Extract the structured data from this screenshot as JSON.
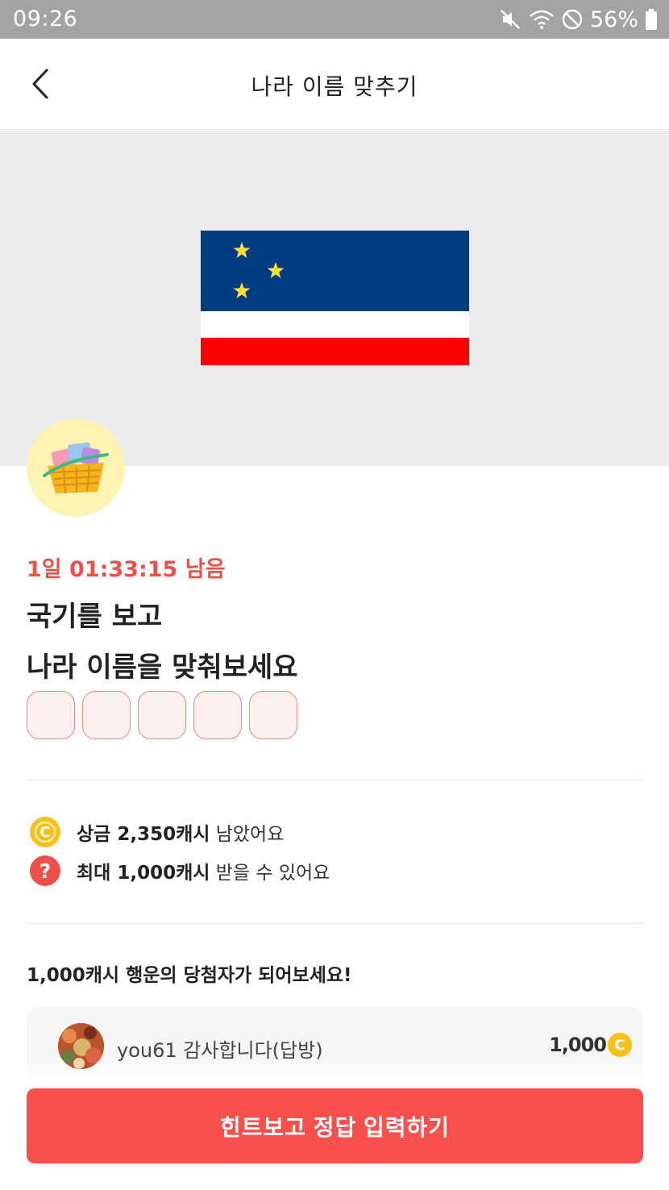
{
  "status_bar": {
    "time": "09:26",
    "battery_percent": "56%",
    "icons": [
      "mute-icon",
      "wifi-icon",
      "block-icon",
      "battery-icon"
    ]
  },
  "header": {
    "title": "나라 이름 맞추기",
    "back_icon": "chevron-left-icon"
  },
  "hero": {
    "flag_colors": {
      "top": "#003c82",
      "middle": "#ffffff",
      "bottom": "#ff0000",
      "stars": "#ffe033"
    },
    "badge_icon": "gift-basket-icon"
  },
  "quiz": {
    "timer": "1일 01:33:15 남음",
    "question_line1": "국기를 보고",
    "question_line2": "나라 이름을 맞춰보세요",
    "answer_length": 5
  },
  "info": {
    "prize": {
      "icon": "coin-icon",
      "bold": "상금 2,350캐시",
      "rest": " 남았어요"
    },
    "max": {
      "icon": "question-icon",
      "bold": "최대 1,000캐시",
      "rest": " 받을 수 있어요"
    }
  },
  "winners": {
    "heading": "1,000캐시 행운의 당첨자가 되어보세요!",
    "items": [
      {
        "name": "you61 감사합니다(답방)",
        "amount": "1,000",
        "coin_glyph": "C"
      }
    ]
  },
  "coin_glyph": "C",
  "question_glyph": "?",
  "cta": {
    "label": "힌트보고 정답 입력하기"
  },
  "colors": {
    "accent": "#f7504d",
    "timer": "#e5534b",
    "coin": "#f6c21a"
  }
}
